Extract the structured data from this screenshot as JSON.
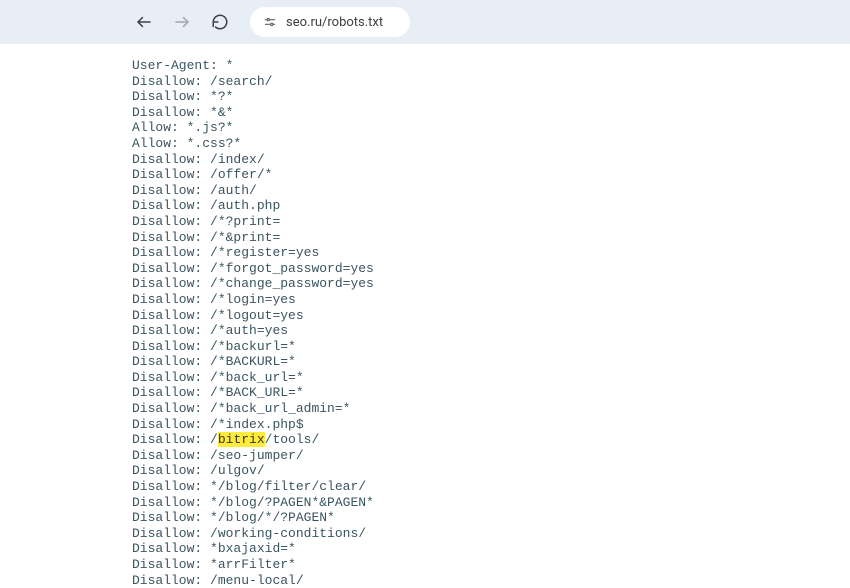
{
  "toolbar": {
    "url": "seo.ru/robots.txt"
  },
  "robots": {
    "lines": [
      {
        "d": "User-Agent:",
        "p": "*"
      },
      {
        "d": "Disallow:",
        "p": "/search/"
      },
      {
        "d": "Disallow:",
        "p": "*?*"
      },
      {
        "d": "Disallow:",
        "p": "*&*"
      },
      {
        "d": "Allow:",
        "p": "*.js?*"
      },
      {
        "d": "Allow:",
        "p": "*.css?*"
      },
      {
        "d": "Disallow:",
        "p": "/index/"
      },
      {
        "d": "Disallow:",
        "p": "/offer/*"
      },
      {
        "d": "Disallow:",
        "p": "/auth/"
      },
      {
        "d": "Disallow:",
        "p": "/auth.php"
      },
      {
        "d": "Disallow:",
        "p": "/*?print="
      },
      {
        "d": "Disallow:",
        "p": "/*&print="
      },
      {
        "d": "Disallow:",
        "p": "/*register=yes"
      },
      {
        "d": "Disallow:",
        "p": "/*forgot_password=yes"
      },
      {
        "d": "Disallow:",
        "p": "/*change_password=yes"
      },
      {
        "d": "Disallow:",
        "p": "/*login=yes"
      },
      {
        "d": "Disallow:",
        "p": "/*logout=yes"
      },
      {
        "d": "Disallow:",
        "p": "/*auth=yes"
      },
      {
        "d": "Disallow:",
        "p": "/*backurl=*"
      },
      {
        "d": "Disallow:",
        "p": "/*BACKURL=*"
      },
      {
        "d": "Disallow:",
        "p": "/*back_url=*"
      },
      {
        "d": "Disallow:",
        "p": "/*BACK_URL=*"
      },
      {
        "d": "Disallow:",
        "p": "/*back_url_admin=*"
      },
      {
        "d": "Disallow:",
        "p": "/*index.php$"
      },
      {
        "d": "Disallow:",
        "p_pre": "/",
        "hl": "bitrix",
        "p_post": "/tools/"
      },
      {
        "d": "Disallow:",
        "p": "/seo-jumper/"
      },
      {
        "d": "Disallow:",
        "p": "/ulgov/"
      },
      {
        "d": "Disallow:",
        "p": "*/blog/filter/clear/"
      },
      {
        "d": "Disallow:",
        "p": "*/blog/?PAGEN*&PAGEN*"
      },
      {
        "d": "Disallow:",
        "p": "*/blog/*/?PAGEN*"
      },
      {
        "d": "Disallow:",
        "p": "/working-conditions/"
      },
      {
        "d": "Disallow:",
        "p": "*bxajaxid=*"
      },
      {
        "d": "Disallow:",
        "p": "*arrFilter*"
      },
      {
        "d": "Disallow:",
        "p": "/menu-local/"
      }
    ]
  }
}
